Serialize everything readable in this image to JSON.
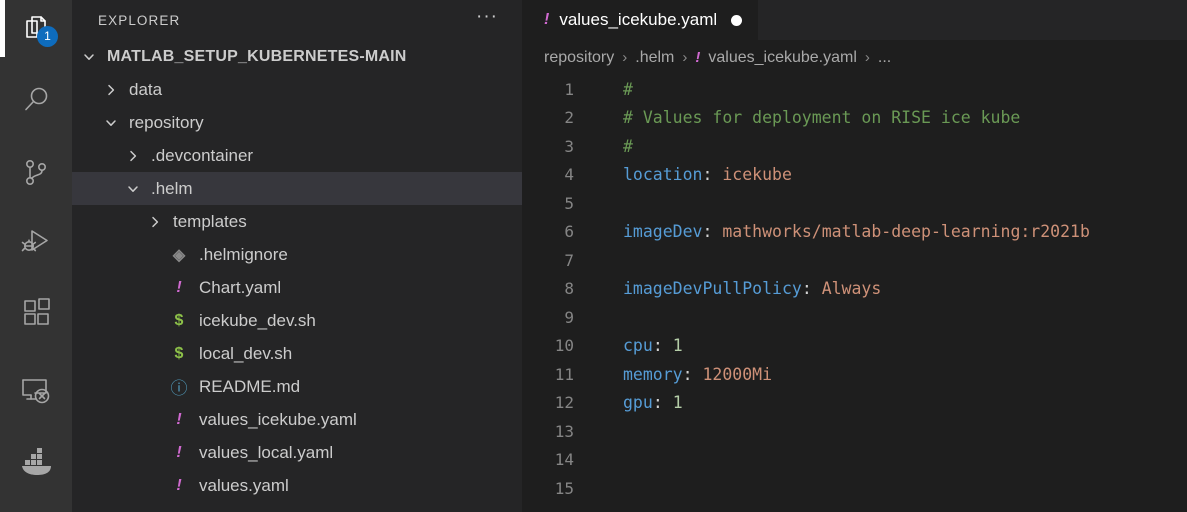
{
  "activity_bar": {
    "items": [
      {
        "name": "explorer",
        "icon": "files-icon",
        "active": true,
        "badge": "1"
      },
      {
        "name": "search",
        "icon": "search-icon",
        "active": false,
        "badge": ""
      },
      {
        "name": "source-control",
        "icon": "source-control-icon",
        "active": false,
        "badge": ""
      },
      {
        "name": "run-and-debug",
        "icon": "run-debug-icon",
        "active": false,
        "badge": ""
      },
      {
        "name": "extensions",
        "icon": "extensions-icon",
        "active": false,
        "badge": ""
      },
      {
        "name": "remote-explorer",
        "icon": "remote-explorer-icon",
        "active": false,
        "badge": ""
      },
      {
        "name": "docker",
        "icon": "docker-icon",
        "active": false,
        "badge": ""
      }
    ]
  },
  "sidebar": {
    "title": "EXPLORER",
    "more_actions": "···",
    "tree": [
      {
        "label": "MATLAB_SETUP_KUBERNETES-MAIN",
        "type": "root",
        "indent": 0,
        "state": "expanded",
        "icon": "",
        "selected": false
      },
      {
        "label": "data",
        "type": "folder",
        "indent": 1,
        "state": "collapsed",
        "icon": "",
        "selected": false
      },
      {
        "label": "repository",
        "type": "folder",
        "indent": 1,
        "state": "expanded",
        "icon": "",
        "selected": false
      },
      {
        "label": ".devcontainer",
        "type": "folder",
        "indent": 2,
        "state": "collapsed",
        "icon": "",
        "selected": false
      },
      {
        "label": ".helm",
        "type": "folder",
        "indent": 2,
        "state": "expanded",
        "icon": "",
        "selected": true
      },
      {
        "label": "templates",
        "type": "folder",
        "indent": 3,
        "state": "collapsed",
        "icon": "",
        "selected": false
      },
      {
        "label": ".helmignore",
        "type": "file",
        "indent": 3,
        "state": "",
        "icon": "git",
        "glyph": "◈",
        "selected": false
      },
      {
        "label": "Chart.yaml",
        "type": "file",
        "indent": 3,
        "state": "",
        "icon": "yaml",
        "glyph": "!",
        "selected": false
      },
      {
        "label": "icekube_dev.sh",
        "type": "file",
        "indent": 3,
        "state": "",
        "icon": "sh",
        "glyph": "$",
        "selected": false
      },
      {
        "label": "local_dev.sh",
        "type": "file",
        "indent": 3,
        "state": "",
        "icon": "sh",
        "glyph": "$",
        "selected": false
      },
      {
        "label": "README.md",
        "type": "file",
        "indent": 3,
        "state": "",
        "icon": "md",
        "glyph": "ⓘ",
        "selected": false
      },
      {
        "label": "values_icekube.yaml",
        "type": "file",
        "indent": 3,
        "state": "",
        "icon": "yaml",
        "glyph": "!",
        "selected": false
      },
      {
        "label": "values_local.yaml",
        "type": "file",
        "indent": 3,
        "state": "",
        "icon": "yaml",
        "glyph": "!",
        "selected": false
      },
      {
        "label": "values.yaml",
        "type": "file",
        "indent": 3,
        "state": "",
        "icon": "yaml",
        "glyph": "!",
        "selected": false
      }
    ]
  },
  "editor": {
    "tabs": [
      {
        "label": "values_icekube.yaml",
        "icon_glyph": "!",
        "dirty": true,
        "active": true
      }
    ],
    "breadcrumb": [
      {
        "label": "repository",
        "icon_glyph": ""
      },
      {
        "label": ".helm",
        "icon_glyph": ""
      },
      {
        "label": "values_icekube.yaml",
        "icon_glyph": "!"
      },
      {
        "label": "...",
        "icon_glyph": ""
      }
    ],
    "breadcrumb_separator": "›",
    "lines": [
      {
        "num": "1",
        "tokens": [
          {
            "t": "#",
            "c": "comment"
          }
        ]
      },
      {
        "num": "2",
        "tokens": [
          {
            "t": "# Values for deployment on RISE ice kube",
            "c": "comment"
          }
        ]
      },
      {
        "num": "3",
        "tokens": [
          {
            "t": "#",
            "c": "comment"
          }
        ]
      },
      {
        "num": "4",
        "tokens": [
          {
            "t": "location",
            "c": "key"
          },
          {
            "t": ": ",
            "c": "punct"
          },
          {
            "t": "icekube",
            "c": "str"
          }
        ]
      },
      {
        "num": "5",
        "tokens": []
      },
      {
        "num": "6",
        "tokens": [
          {
            "t": "imageDev",
            "c": "key"
          },
          {
            "t": ": ",
            "c": "punct"
          },
          {
            "t": "mathworks/matlab-deep-learning:r2021b",
            "c": "str"
          }
        ]
      },
      {
        "num": "7",
        "tokens": []
      },
      {
        "num": "8",
        "tokens": [
          {
            "t": "imageDevPullPolicy",
            "c": "key"
          },
          {
            "t": ": ",
            "c": "punct"
          },
          {
            "t": "Always",
            "c": "str"
          }
        ]
      },
      {
        "num": "9",
        "tokens": []
      },
      {
        "num": "10",
        "tokens": [
          {
            "t": "cpu",
            "c": "key"
          },
          {
            "t": ": ",
            "c": "punct"
          },
          {
            "t": "1",
            "c": "num"
          }
        ]
      },
      {
        "num": "11",
        "tokens": [
          {
            "t": "memory",
            "c": "key"
          },
          {
            "t": ": ",
            "c": "punct"
          },
          {
            "t": "12000Mi",
            "c": "str"
          }
        ]
      },
      {
        "num": "12",
        "tokens": [
          {
            "t": "gpu",
            "c": "key"
          },
          {
            "t": ": ",
            "c": "punct"
          },
          {
            "t": "1",
            "c": "num"
          }
        ]
      },
      {
        "num": "13",
        "tokens": []
      },
      {
        "num": "14",
        "tokens": []
      },
      {
        "num": "15",
        "tokens": []
      }
    ]
  },
  "colors": {
    "activity_bar_bg": "#333333",
    "sidebar_bg": "#252526",
    "editor_bg": "#1e1e1e",
    "selection_bg": "#37373d",
    "badge_bg": "#0e6cbd",
    "comment": "#6a9955",
    "key": "#569cd6",
    "string": "#ce9178",
    "number": "#b5cea8",
    "yaml_icon": "#d06ad0",
    "sh_icon": "#8dc149",
    "md_icon": "#519aba"
  }
}
